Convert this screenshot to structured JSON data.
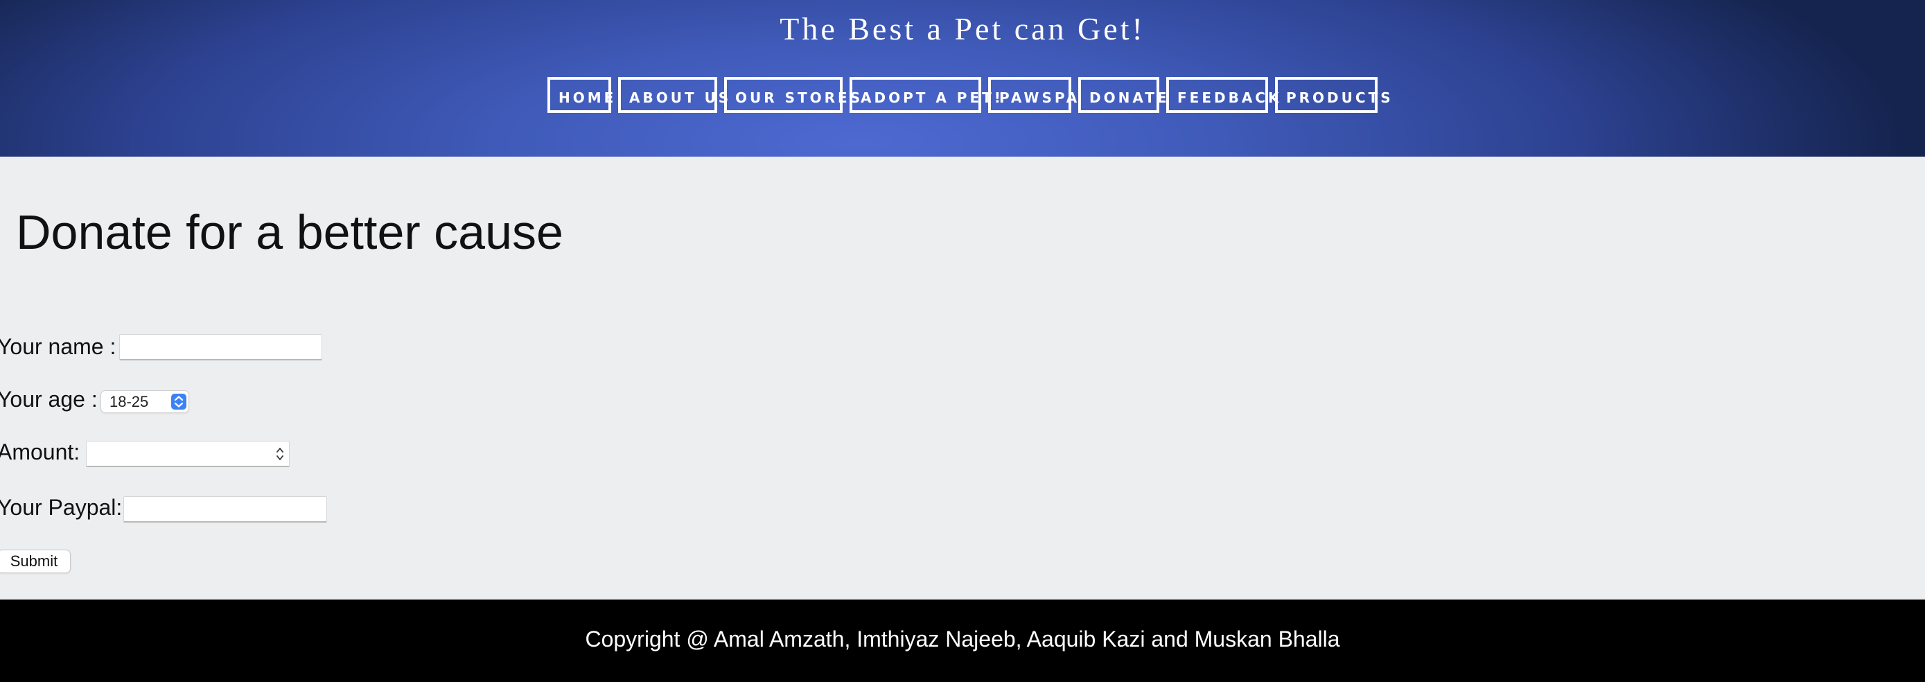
{
  "header": {
    "title": "The Best a Pet can Get!",
    "nav": [
      {
        "label": "HOME"
      },
      {
        "label": "ABOUT US"
      },
      {
        "label": "OUR STORES"
      },
      {
        "label": "ADOPT A PET!"
      },
      {
        "label": "PAWSPA"
      },
      {
        "label": "DONATE"
      },
      {
        "label": "FEEDBACK"
      },
      {
        "label": "PRODUCTS"
      }
    ]
  },
  "main": {
    "heading": "Donate for a better cause",
    "form": {
      "name_label": "Your name :",
      "name_value": "",
      "age_label": "Your age :",
      "age_selected": "18-25",
      "amount_label": "Amount:",
      "amount_value": "",
      "paypal_label": "Your Paypal:",
      "paypal_value": "",
      "submit_label": "Submit"
    }
  },
  "footer": {
    "copyright": "Copyright @ Amal Amzath, Imthiyaz Najeeb, Aaquib Kazi and Muskan Bhalla"
  },
  "colors": {
    "header_gradient_center": "#4e6ad2",
    "header_gradient_edge": "#15244f",
    "page_background": "#edeef0",
    "footer_background": "#000000",
    "select_accent": "#3d82f4"
  },
  "icons": {
    "select_arrows": "up-down-chevron-icon",
    "number_spinner": "spinner-arrows-icon"
  }
}
